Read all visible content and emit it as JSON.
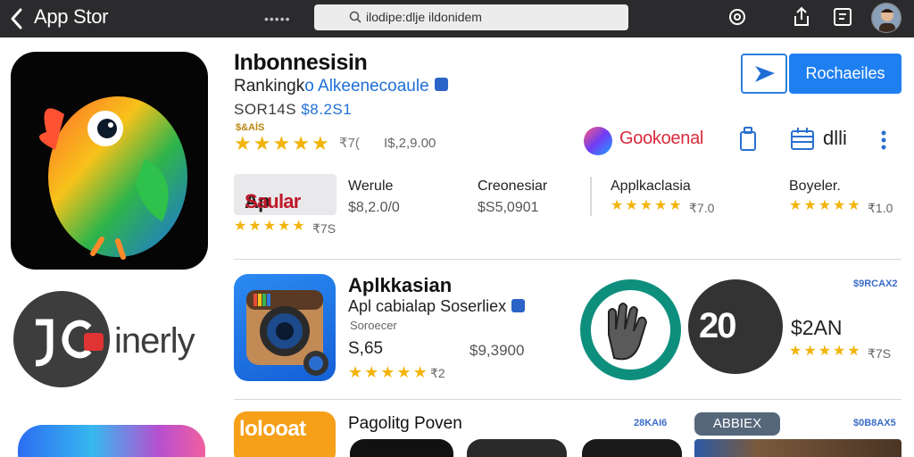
{
  "topbar": {
    "title": "App Stor",
    "url": "ilodipe:dlje ildonidem",
    "dots": "•••••"
  },
  "left": {
    "logo_word": "inerly"
  },
  "featured": {
    "title": "Inbonnesisin",
    "subtitle_plain": "Rankingk",
    "subtitle_blue": "o Alkeenecoaule",
    "price_code": "SOR14S",
    "price_blue": "$8.2S1",
    "small_tag": "$&AİS",
    "rating_count": "₹7(",
    "extra_price": "I$,2,9.00",
    "rating": 5,
    "get_label": "Rochaeiles",
    "brand": "Gookoenal",
    "brand2": "dlli"
  },
  "row1": {
    "tile_ap": "Ap",
    "tile_rest": "Saular",
    "tile_count": "₹7S",
    "cols": [
      {
        "title": "Werule",
        "price": "$8,2.0/0"
      },
      {
        "title": "Creonesiar",
        "price": "$S5,0901"
      },
      {
        "title": "Applkaclasia",
        "price": "₹7.0"
      },
      {
        "title": "Boyeler.",
        "price": "₹1.0"
      }
    ]
  },
  "section2": {
    "title": "Aplkkasian",
    "subtitle": "Apl cabialap Soserliex",
    "small": "Soroecer",
    "price": "S,65",
    "price2": "$9,3900",
    "count": "₹2",
    "tag1": "$9RCAX2",
    "big_price": "$2AN",
    "rate_right": "₹7S",
    "circle_text": "20"
  },
  "section3": {
    "tile_text": "lolooat",
    "title": "Pagolitg Poven",
    "tag1": "28KAI6",
    "pill": "ABBIEX",
    "tag2": "$0B8AX5"
  }
}
